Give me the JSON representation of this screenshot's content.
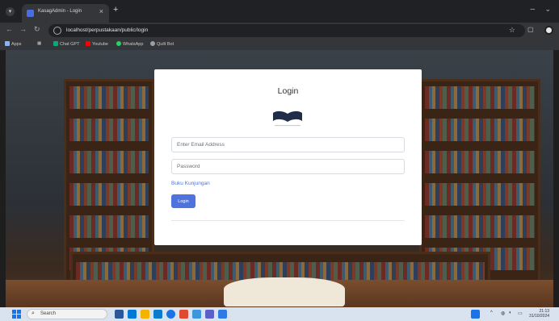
{
  "browser": {
    "tab_title": "KasagAdmin - Login",
    "new_tab_icon": "plus-icon",
    "url": "localhost/perpustakaan/public/login"
  },
  "bookmarks": [
    {
      "label": "Apps",
      "color": "#8ab4f8"
    },
    {
      "label": "Chat GPT",
      "color": "#10a37f"
    },
    {
      "label": "Youtube",
      "color": "#ff0000"
    },
    {
      "label": "WhatsApp",
      "color": "#25d366"
    },
    {
      "label": "Quilt Bot",
      "color": "#9aa0a6"
    }
  ],
  "login": {
    "title": "Login",
    "email_placeholder": "Enter Email Address",
    "password_placeholder": "Password",
    "guest_link": "Buku Kunjungan",
    "submit_label": "Login",
    "accent": "#4e73df"
  },
  "taskbar": {
    "search_label": "Search",
    "time": "21:13",
    "date": "31/10/2024"
  }
}
